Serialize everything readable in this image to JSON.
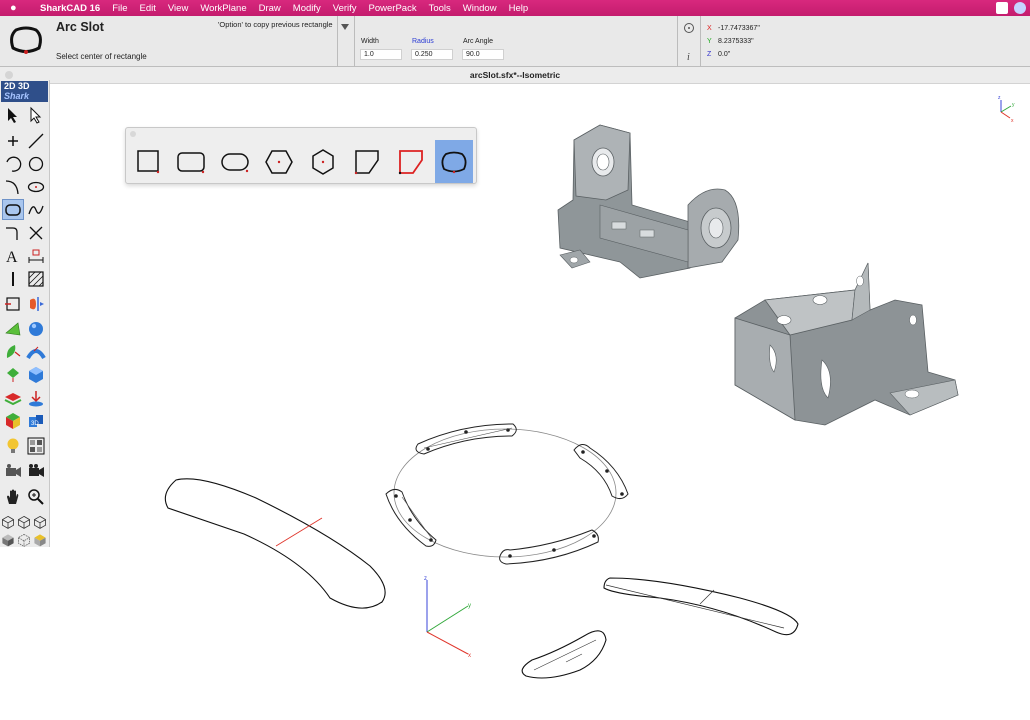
{
  "menubar": {
    "app_name": "SharkCAD 16",
    "items": [
      "File",
      "Edit",
      "View",
      "WorkPlane",
      "Draw",
      "Modify",
      "Verify",
      "PowerPack",
      "Tools",
      "Window",
      "Help"
    ]
  },
  "tool": {
    "title": "Arc Slot",
    "hint": "'Option' to copy previous rectangle",
    "prompt": "Select center of rectangle",
    "params": [
      {
        "label": "Width",
        "value": "1.0"
      },
      {
        "label": "Radius",
        "value": "0.250"
      },
      {
        "label": "Arc Angle",
        "value": "90.0"
      }
    ]
  },
  "coords": {
    "x_label": "X",
    "x_value": "-17.7473367\"",
    "y_label": "Y",
    "y_value": "8.2375333\"",
    "z_label": "Z",
    "z_value": "0.0\""
  },
  "document": {
    "title": "arcSlot.sfx*--Isometric"
  },
  "palette": {
    "logo_2d3d": "2D 3D",
    "logo_brand": "Shark"
  },
  "axis_labels": {
    "x": "x",
    "y": "y",
    "z": "z"
  },
  "colors": {
    "menubar": "#c41c6e",
    "accent_blue": "#2a3bd4",
    "selection": "#7fa9e6",
    "model_gray": "#9ea1a4",
    "axis_x": "#e0352b",
    "axis_y": "#31a83a",
    "axis_z": "#3a45d8"
  }
}
